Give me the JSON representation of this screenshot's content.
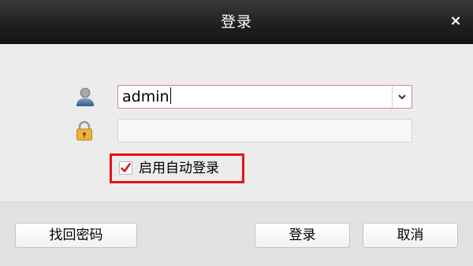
{
  "dialog": {
    "title": "登录",
    "close_glyph": "×"
  },
  "form": {
    "username_value": "admin",
    "password_value": "",
    "auto_login_label": "启用自动登录",
    "auto_login_checked": true
  },
  "buttons": {
    "find_password": "找回密码",
    "login": "登录",
    "cancel": "取消"
  },
  "icons": {
    "user": "user-icon",
    "lock": "lock-icon",
    "dropdown": "chevron-down-icon",
    "close": "close-icon",
    "check": "checkmark-icon"
  },
  "colors": {
    "titlebar": "#1e1e1e",
    "highlight": "#e0141c",
    "checkmark": "#d0161d",
    "focus_border": "#d98585"
  }
}
